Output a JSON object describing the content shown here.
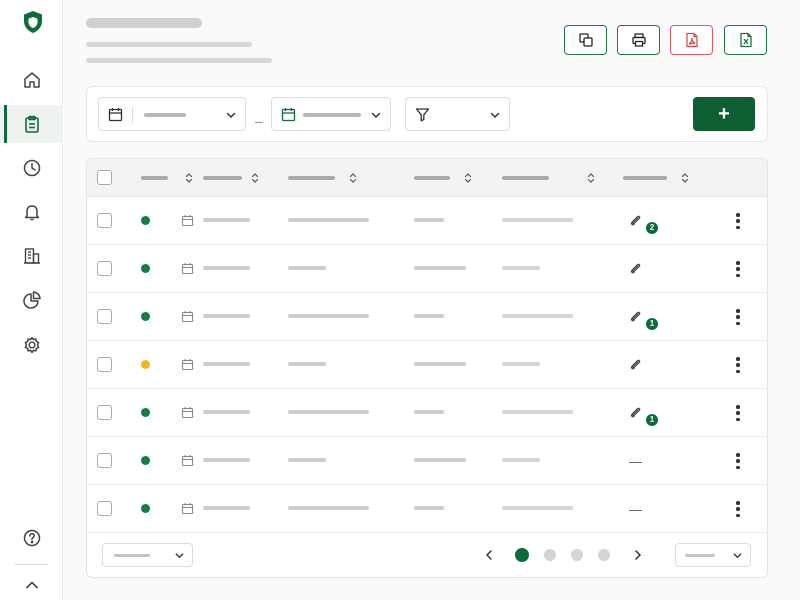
{
  "sidebar": {
    "logo_icon": "shield-icon",
    "items": [
      {
        "name": "home",
        "icon": "home-icon",
        "active": false
      },
      {
        "name": "clipboard",
        "icon": "clipboard-icon",
        "active": true
      },
      {
        "name": "history",
        "icon": "clock-icon",
        "active": false
      },
      {
        "name": "notifications",
        "icon": "bell-icon",
        "active": false
      },
      {
        "name": "buildings",
        "icon": "building-icon",
        "active": false
      },
      {
        "name": "reports",
        "icon": "pie-chart-icon",
        "active": false
      },
      {
        "name": "settings",
        "icon": "gear-icon",
        "active": false
      }
    ],
    "help_icon": "help-icon",
    "collapse_icon": "chevron-up-icon"
  },
  "toolbar": {
    "buttons": [
      "copy-icon",
      "print-icon",
      "pdf-icon",
      "excel-icon"
    ]
  },
  "filters": {
    "start_date_icon": "calendar-icon",
    "separator": "–",
    "end_date_icon": "calendar-icon",
    "filter_icon": "filter-icon",
    "add_label": "+"
  },
  "colors": {
    "accent": "#0f6b3c",
    "status_green": "#11803f",
    "status_yellow": "#f1b619",
    "pdf_red": "#d85a5a"
  },
  "table": {
    "rows": [
      {
        "status": "green",
        "attachments": "2",
        "has_attachment": true
      },
      {
        "status": "green",
        "attachments": "",
        "has_attachment": true
      },
      {
        "status": "green",
        "attachments": "1",
        "has_attachment": true
      },
      {
        "status": "yellow",
        "attachments": "",
        "has_attachment": true
      },
      {
        "status": "green",
        "attachments": "1",
        "has_attachment": true
      },
      {
        "status": "green",
        "attachments": "—",
        "has_attachment": false
      },
      {
        "status": "green",
        "attachments": "—",
        "has_attachment": false
      }
    ]
  },
  "pagination": {
    "pages": 4,
    "current": 1
  }
}
